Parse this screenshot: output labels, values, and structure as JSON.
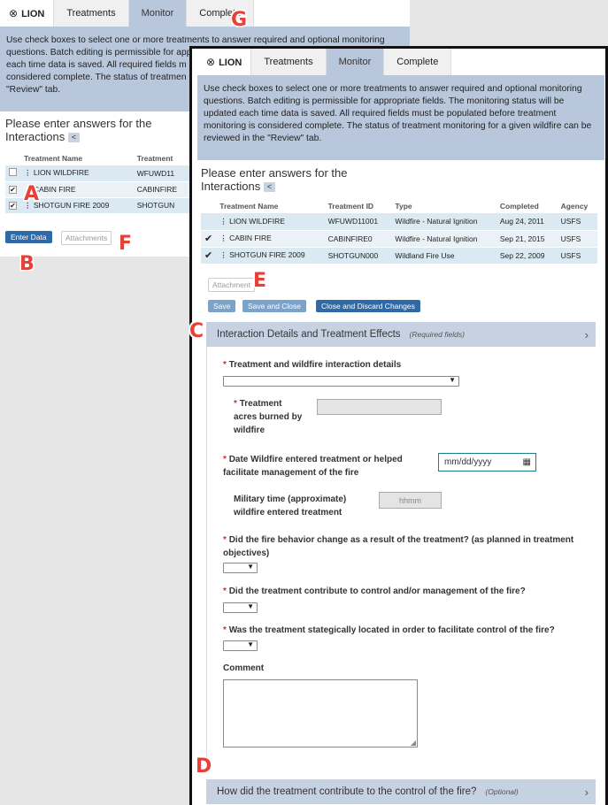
{
  "tabs": {
    "home": "LION",
    "treatments": "Treatments",
    "monitor": "Monitor",
    "complete": "Complete"
  },
  "intro_text": "Use check boxes to select one or more treatments to answer required and optional monitoring questions. Batch editing is permissible for appropriate fields. The monitoring status will be updated each time data is saved. All required fields must be populated before treatment monitoring is considered complete. The status of treatment monitoring for a given wildfire can be reviewed in the \"Review\" tab.",
  "back_intro_lines": [
    "Use check boxes to select one or more treatments to answer required and optional monitoring",
    "questions. Batch editing is permissible for app",
    "each time data is saved. All required fields m",
    "considered complete. The status of treatmen",
    "\"Review\" tab."
  ],
  "prompt": {
    "line1": "Please enter answers for the",
    "line2": "Interactions",
    "collapse": "<"
  },
  "back_table": {
    "headers": [
      "Treatment Name",
      "Treatment"
    ],
    "rows": [
      {
        "name": "LION WILDFIRE",
        "id": "WFUWD11",
        "checked": ""
      },
      {
        "name": "CABIN FIRE",
        "id": "CABINFIRE",
        "checked": "✔"
      },
      {
        "name": "SHOTGUN FIRE 2009",
        "id": "SHOTGUN",
        "checked": "✔"
      }
    ]
  },
  "back_buttons": {
    "enter_data": "Enter Data",
    "attachments": "Attachments"
  },
  "front_table": {
    "headers": [
      "Treatment Name",
      "Treatment ID",
      "Type",
      "Completed",
      "Agency"
    ],
    "rows": [
      {
        "check": "",
        "name": "LION WILDFIRE",
        "id": "WFUWD11001",
        "type": "Wildfire - Natural Ignition",
        "completed": "Aug 24, 2011",
        "agency": "USFS"
      },
      {
        "check": "✔",
        "name": "CABIN FIRE",
        "id": "CABINFIRE0",
        "type": "Wildfire - Natural Ignition",
        "completed": "Sep 21, 2015",
        "agency": "USFS"
      },
      {
        "check": "✔",
        "name": "SHOTGUN FIRE 2009",
        "id": "SHOTGUN000",
        "type": "Wildland Fire Use",
        "completed": "Sep 22, 2009",
        "agency": "USFS"
      }
    ]
  },
  "front_buttons": {
    "attachments": "Attachment",
    "save": "Save",
    "save_close": "Save and Close",
    "close_discard": "Close and Discard Changes"
  },
  "section1": {
    "title": "Interaction Details and Treatment Effects",
    "note": "(Required fields)"
  },
  "form": {
    "q_interaction": "Treatment and wildfire interaction details",
    "q_acres_1": "Treatment",
    "q_acres_2": "acres burned by",
    "q_acres_3": "wildfire",
    "q_date_1": "Date Wildfire entered treatment or helped",
    "q_date_2": "facilitate management of the fire",
    "date_placeholder": "mm/dd/yyyy",
    "q_time_1": "Military time (approximate)",
    "q_time_2": "wildfire entered treatment",
    "time_placeholder": "hhmm",
    "q_behavior_1": "Did the fire behavior change as a result of the treatment? (as planned in treatment",
    "q_behavior_2": "objectives)",
    "q_contribute": "Did the treatment contribute to control and/or management of the fire?",
    "q_located": "Was the treatment stategically located in order to facilitate control of the fire?",
    "comment_label": "Comment",
    "required_mark": "*"
  },
  "section2": {
    "title": "How did the treatment contribute to the control of the fire?",
    "note": "(Optional)"
  },
  "markers": {
    "a": "A",
    "b": "B",
    "c": "C",
    "d": "D",
    "e": "E",
    "f": "F",
    "g": "G"
  },
  "colors": {
    "tab_active": "#b8c7db",
    "primary_button": "#2e6aa8",
    "marker": "#e83f37",
    "section_bar": "#c6d2e2"
  }
}
